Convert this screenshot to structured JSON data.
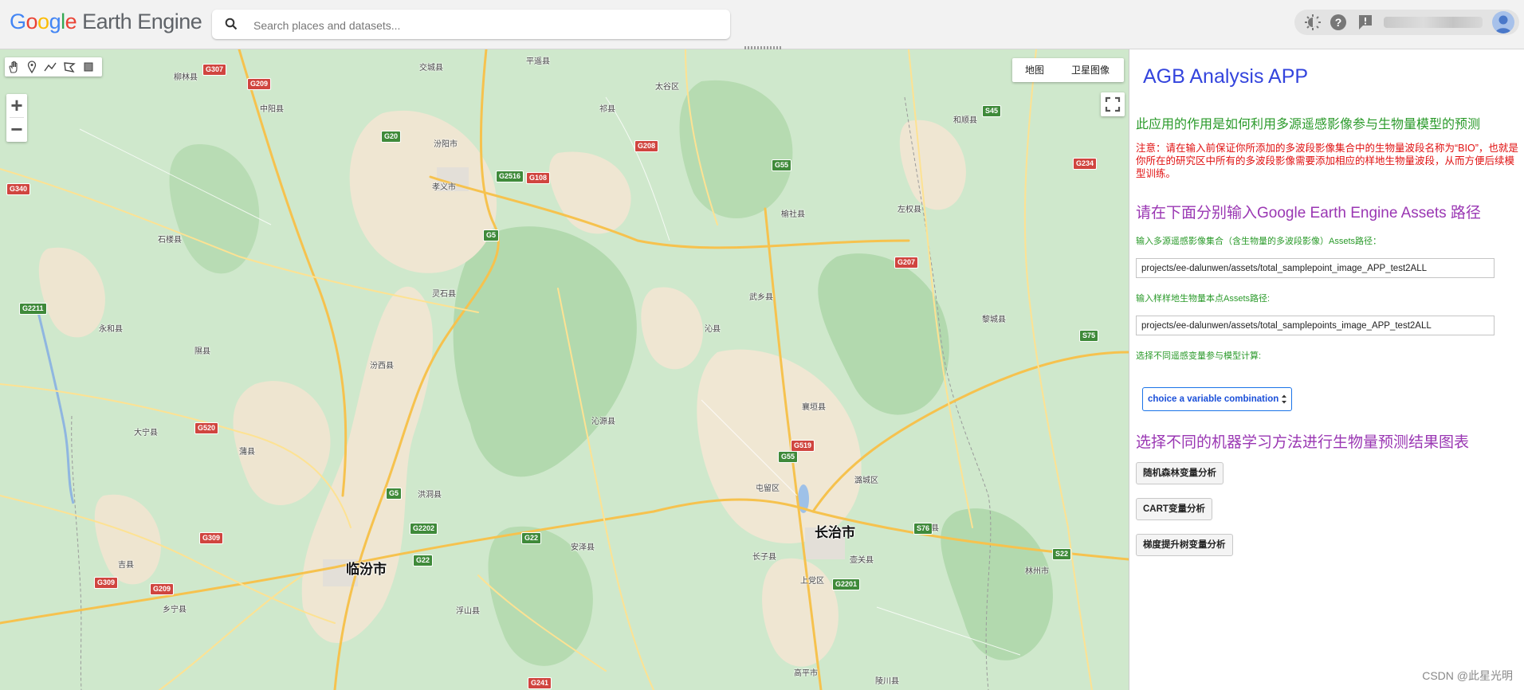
{
  "header": {
    "logo_google": "Google",
    "logo_product": "Earth Engine",
    "search_placeholder": "Search places and datasets..."
  },
  "map": {
    "drawing_tools": [
      "hand-tool",
      "point-tool",
      "line-tool",
      "polygon-tool",
      "rectangle-tool"
    ],
    "zoom_in": "+",
    "zoom_out": "−",
    "map_type_buttons": [
      "地图",
      "卫星图像"
    ],
    "cities": [
      "临汾市",
      "长治市"
    ],
    "places": [
      "柳林县",
      "中阳县",
      "交城县",
      "汾阳市",
      "孝义市",
      "太谷区",
      "祁县",
      "石楼县",
      "灵石县",
      "永和县",
      "隰县",
      "汾西县",
      "洪洞县",
      "大宁县",
      "蒲县",
      "吉县",
      "乡宁县",
      "安泽县",
      "屯留区",
      "潞城区",
      "长子县",
      "上党区",
      "壶关县",
      "平顺县",
      "襄垣县",
      "武乡县",
      "沁县",
      "沁源县",
      "黎城县",
      "左权县",
      "和顺县",
      "榆社县",
      "林州市",
      "陵川县",
      "高平市",
      "浮山县",
      "平遥县"
    ],
    "road_shields": [
      "G307",
      "G209",
      "G20",
      "G340",
      "G5",
      "G2516",
      "G108",
      "G208",
      "G55",
      "S45",
      "G207",
      "G234",
      "G2211",
      "G241",
      "G22",
      "G309",
      "G520",
      "S75",
      "G2202",
      "G519",
      "S76",
      "S22",
      "G2201",
      "G5",
      "G55",
      "G22",
      "G209",
      "G309"
    ]
  },
  "panel": {
    "title": "AGB Analysis APP",
    "description": "此应用的作用是如何利用多源遥感影像参与生物量模型的预测",
    "notice": "注意：请在输入前保证你所添加的多波段影像集合中的生物量波段名称为“BIO”，也就是你所在的研究区中所有的多波段影像需要添加相应的样地生物量波段，从而方便后续模型训练。",
    "assets_heading": "请在下面分别输入Google Earth Engine Assets 路径",
    "image_label": "输入多源遥感影像集合（含生物量的多波段影像）Assets路径：",
    "image_value": "projects/ee-dalunwen/assets/total_samplepoint_image_APP_test2ALL",
    "points_label": "输入样样地生物量本点Assets路径:",
    "points_value": "projects/ee-dalunwen/assets/total_samplepoints_image_APP_test2ALL",
    "vars_label": "选择不同遥感变量参与模型计算:",
    "select_value": "choice a variable combination",
    "ml_heading": "选择不同的机器学习方法进行生物量预测结果图表",
    "btn_rf": "随机森林变量分析",
    "btn_cart": "CART变量分析",
    "btn_gbt": "梯度提升树变量分析"
  },
  "watermark": "CSDN @此星光明",
  "colors": {
    "title_blue": "#3344dd",
    "description_green": "#2a9a2a",
    "notice_red": "#e01010",
    "heading_purple": "#9a37b3",
    "select_blue": "#1a73e8"
  }
}
